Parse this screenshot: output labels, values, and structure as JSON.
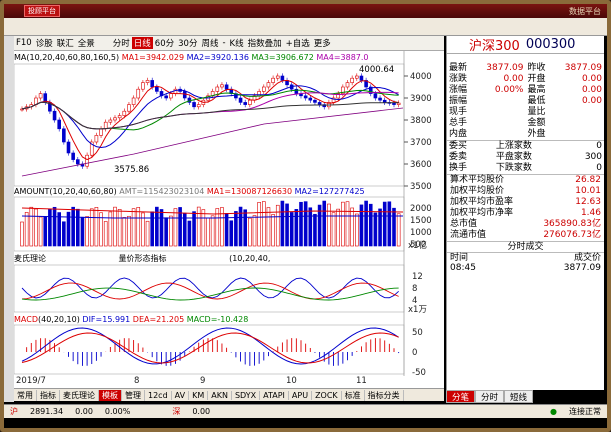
{
  "topbar": {
    "logo": "投顾平台",
    "right": "数据平台"
  },
  "toolbar": {
    "items": [
      "分时",
      "日线",
      "60分",
      "30分",
      "周线",
      "-",
      "K线",
      "指数叠加",
      "+自选",
      "更多"
    ],
    "selected": "日线"
  },
  "left_toolbar": [
    "F10",
    "诊股",
    "联汇",
    "全景"
  ],
  "kline_legend": {
    "prefix": "MA",
    "params": "(10,20,40,60,80,160,5)",
    "ma1": "MA1=3942.029",
    "ma2": "MA2=3920.136",
    "ma3": "MA3=3906.672",
    "ma4": "MA4=3887.0"
  },
  "amount_legend": {
    "name": "AMOUNT",
    "params": "(10,20,40,60,80)",
    "amt": "AMT=115423023104",
    "ma1": "MA1=130087126630",
    "ma2": "MA2=127277425"
  },
  "mid_legend": {
    "name": "麦氏理论",
    "center": "量价形态指标",
    "right": "(10,20,40,"
  },
  "macd_legend": {
    "name": "MACD",
    "params": "(40,20,10)",
    "dif": "DIF=15.991",
    "dea": "DEA=21.205",
    "macd": "MACD=-10.428"
  },
  "ticks": {
    "price": [
      "4000",
      "3900",
      "3800",
      "3700",
      "3600",
      "3500"
    ],
    "amount": [
      "2000",
      "1500",
      "1000",
      "500"
    ],
    "amount_unit": "x1亿",
    "mid": [
      "12",
      "8",
      "4"
    ],
    "mid_unit": "x1万",
    "macd": [
      "50",
      "0",
      "-50"
    ],
    "high": "4000.64",
    "low": "3575.86"
  },
  "dates": [
    "2019/7",
    "8",
    "9",
    "10",
    "11"
  ],
  "bottom_tabs": [
    "常用",
    "指标",
    "麦氏理论",
    "模板",
    "管理",
    "12cd",
    "AV",
    "KM",
    "AKN",
    "SDYX",
    "ATAPI",
    "APU",
    "ZOCK",
    "标准",
    "指标分类"
  ],
  "bottom_selected": "模板",
  "right": {
    "name": "沪深300",
    "code": "000300",
    "rows1": [
      [
        "最新",
        "3877.09",
        "昨收",
        "3877.09"
      ],
      [
        "涨跌",
        "0.00",
        "开盘",
        "0.00"
      ],
      [
        "涨幅",
        "0.00%",
        "最高",
        "0.00"
      ],
      [
        "振幅",
        "",
        "最低",
        "0.00"
      ],
      [
        "现手",
        "",
        "量比",
        ""
      ],
      [
        "总手",
        "",
        "金额",
        ""
      ],
      [
        "内盘",
        "",
        "外盘",
        ""
      ]
    ],
    "rows2": [
      [
        "委买",
        "",
        "上涨家数",
        "0"
      ],
      [
        "委卖",
        "",
        "平盘家数",
        "300"
      ],
      [
        "换手",
        "",
        "下跌家数",
        "0"
      ]
    ],
    "stats": [
      [
        "算术平均股价",
        "26.82"
      ],
      [
        "加权平均股价",
        "10.01"
      ],
      [
        "加权平均市盈率",
        "12.63"
      ],
      [
        "加权平均市净率",
        "1.46"
      ],
      [
        "总市值",
        "365890.83亿"
      ],
      [
        "流通市值",
        "276076.73亿"
      ]
    ],
    "trade_title": "分时成交",
    "trade_head": [
      "时间",
      "成交价"
    ],
    "trade_row": [
      "08:45",
      "3877.09"
    ],
    "tabs": [
      "分笔",
      "分时",
      "短线"
    ]
  },
  "status": {
    "sh_label": "沪",
    "sh_val": "2891.34",
    "sh_chg": "0.00",
    "sh_pct": "0.00%",
    "sz_label": "深",
    "sz_val": "0.00",
    "conn": "连接正常"
  },
  "colors": {
    "up": "#d00000",
    "down": "#0000c8",
    "bg": "#ffffff"
  }
}
